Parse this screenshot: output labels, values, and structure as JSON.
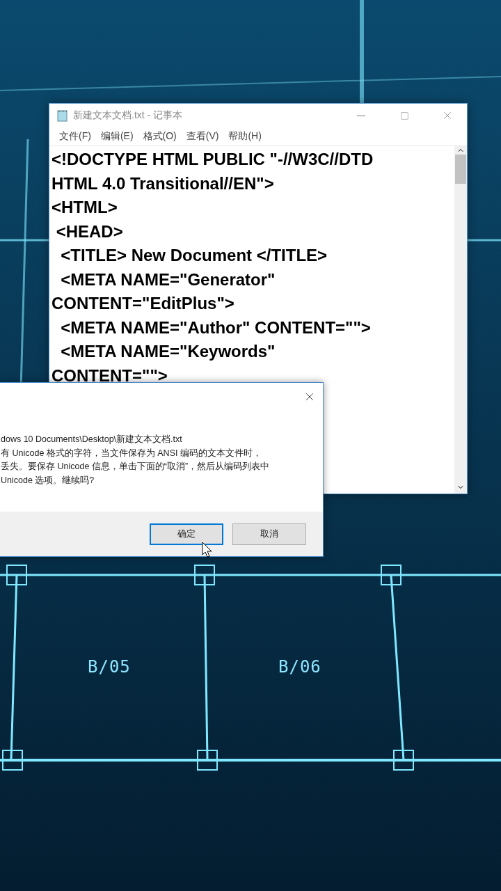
{
  "background": {
    "labels": [
      "B/05",
      "B/06"
    ]
  },
  "notepad": {
    "title": "新建文本文档.txt - 记事本",
    "menu": [
      "文件(F)",
      "编辑(E)",
      "格式(O)",
      "查看(V)",
      "帮助(H)"
    ],
    "lines": [
      "<!DOCTYPE HTML PUBLIC \"-//W3C//DTD",
      "HTML 4.0 Transitional//EN\">",
      "<HTML>",
      " <HEAD>",
      "  <TITLE> New Document </TITLE>",
      "  <META NAME=\"Generator\"",
      "CONTENT=\"EditPlus\">",
      "  <META NAME=\"Author\" CONTENT=\"\">",
      "  <META NAME=\"Keywords\"",
      "CONTENT=\"\">"
    ]
  },
  "dialog": {
    "message_lines": [
      "dows 10 Documents\\Desktop\\新建文本文档.txt",
      "有 Unicode 格式的字符，当文件保存为 ANSI 编码的文本文件时，",
      "丢失。要保存 Unicode 信息，单击下面的“取消”，然后从编码列表中",
      "Unicode 选项。继续吗?"
    ],
    "buttons": [
      {
        "label": "确定",
        "focused": true
      },
      {
        "label": "取消",
        "focused": false
      }
    ]
  }
}
